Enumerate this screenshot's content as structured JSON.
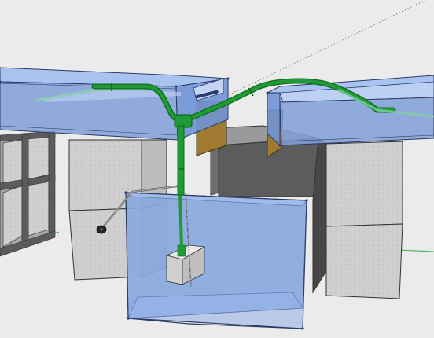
{
  "scene": {
    "kind": "3d-model-viewport",
    "background_color": "#ebebeb",
    "ground_color": "#e6e6e6",
    "colors": {
      "pipe": "#1f9a34",
      "pipe_dark": "#0f6b1e",
      "tank_glass": "#8eaee6",
      "tank_glass_dark": "#6f93d6",
      "tank_edge": "#2b3a66",
      "cinder_block": "#cfcfcf",
      "wood_panel": "#a07a30",
      "frame_steel": "#5b5b5b",
      "wall_gray": "#767676",
      "wall_gray_dark": "#5a5a5a",
      "axis_green": "#2bb54a",
      "axis_dotted": "#888888"
    },
    "components": {
      "left_tank": "glass-tank-left",
      "right_tank": "glass-tank-right",
      "sump_tank": "glass-sump",
      "left_stand": "steel-frame-stand",
      "cinder_stack_left": "cinder-block-stack-left",
      "cinder_stack_right": "cinder-block-stack-right",
      "center_pillar": "gray-concrete-pillar",
      "pump": "submersible-pump",
      "overflow_pipes": "green-overflow-pipes",
      "power_cord": "power-cord"
    }
  }
}
